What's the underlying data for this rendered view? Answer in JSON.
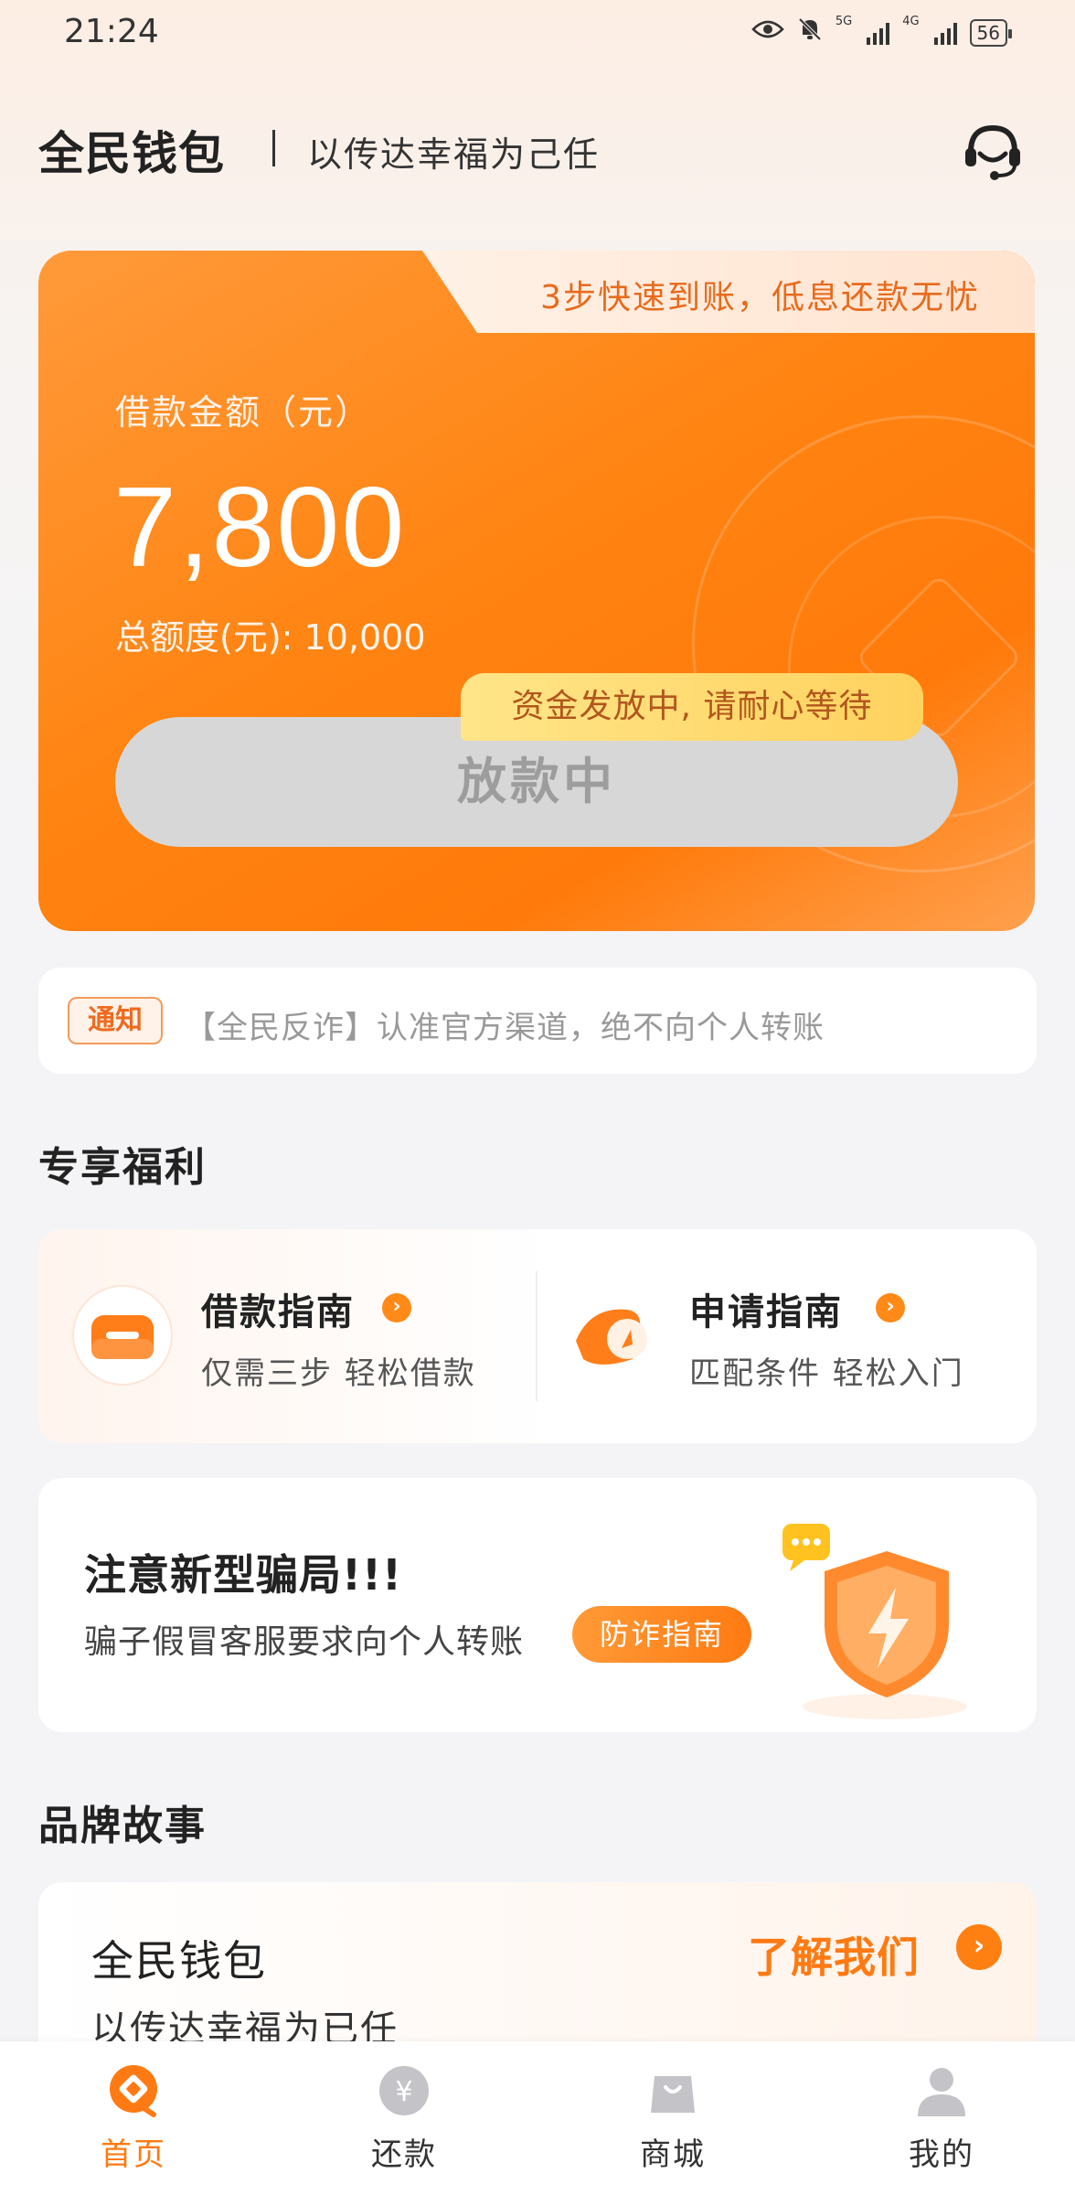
{
  "status_bar": {
    "time": "21:24",
    "network_1": "5G",
    "network_2": "4G",
    "battery": "56"
  },
  "header": {
    "brand": "全民钱包",
    "slogan": "以传达幸福为己任",
    "support_icon": "headset-icon"
  },
  "loan_card": {
    "tab_text": "3步快速到账，低息还款无忧",
    "amount_label": "借款金额（元）",
    "amount": "7,800",
    "total_label": "总额度(元): 10,000",
    "status_tip": "资金发放中, 请耐心等待",
    "button_label": "放款中"
  },
  "notice": {
    "tag": "通知",
    "text": "【全民反诈】认准官方渠道，绝不向个人转账"
  },
  "benefits_section": {
    "title": "专享福利",
    "items": [
      {
        "title": "借款指南",
        "subtitle": "仅需三步 轻松借款",
        "icon": "loan-guide-icon"
      },
      {
        "title": "申请指南",
        "subtitle": "匹配条件 轻松入门",
        "icon": "apply-guide-icon"
      }
    ]
  },
  "fraud_card": {
    "title": "注意新型骗局!!!",
    "subtitle": "骗子假冒客服要求向个人转账",
    "button": "防诈指南"
  },
  "brand_section": {
    "title": "品牌故事",
    "card_title": "全民钱包",
    "card_subtitle": "以传达幸福为已任",
    "link": "了解我们"
  },
  "tabbar": {
    "tabs": [
      {
        "label": "首页",
        "icon": "home-icon",
        "active": true
      },
      {
        "label": "还款",
        "icon": "repay-icon",
        "active": false
      },
      {
        "label": "商城",
        "icon": "shop-icon",
        "active": false
      },
      {
        "label": "我的",
        "icon": "profile-icon",
        "active": false
      }
    ]
  },
  "colors": {
    "accent": "#ff7a12",
    "card_orange": "#ff8412",
    "tip_yellow": "#ffd25e"
  }
}
